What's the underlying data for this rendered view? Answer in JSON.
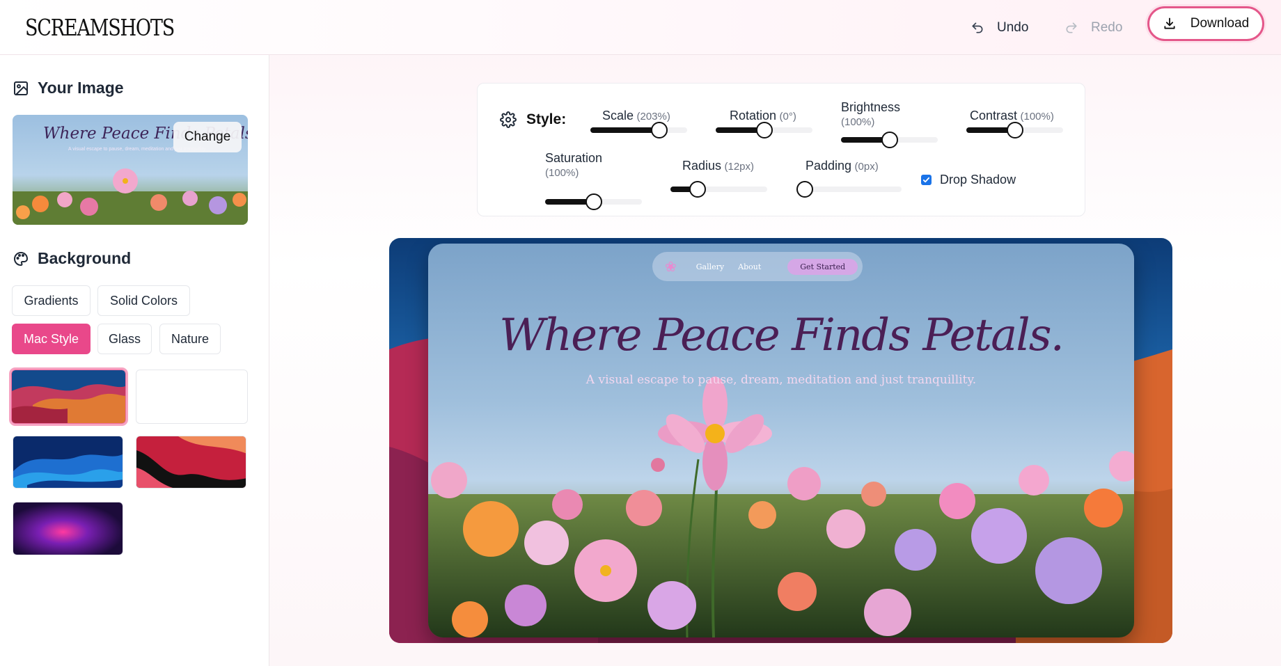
{
  "header": {
    "logo": "SCREAMSHOTS",
    "undo_label": "Undo",
    "redo_label": "Redo",
    "download_label": "Download",
    "undo_icon": "undo-icon",
    "redo_icon": "redo-icon",
    "download_icon": "download-icon"
  },
  "sidebar": {
    "image_section": {
      "title": "Your Image",
      "icon": "image-icon",
      "change_label": "Change"
    },
    "thumbnail": {
      "title": "Where Peace Finds Petals.",
      "subtitle": "A visual escape to pause, dream, meditation and just tranquillity."
    },
    "background_section": {
      "title": "Background",
      "icon": "palette-icon",
      "tabs": [
        "Gradients",
        "Solid Colors",
        "Mac Style",
        "Glass",
        "Nature"
      ],
      "active_tab": "Mac Style",
      "swatches": [
        "mac-sonoma-orange",
        "blank-white",
        "mac-blue-waves",
        "mac-red-black",
        "mac-purple-glow"
      ],
      "selected_swatch": "mac-sonoma-orange"
    }
  },
  "style": {
    "title": "Style:",
    "icon": "gear-icon",
    "controls": {
      "scale": {
        "label": "Scale",
        "unit": "(203%)",
        "level": 0.71
      },
      "rotation": {
        "label": "Rotation",
        "unit": "(0°)",
        "level": 0.5
      },
      "brightness": {
        "label": "Brightness",
        "unit": "(100%)",
        "level": 0.5
      },
      "contrast": {
        "label": "Contrast",
        "unit": "(100%)",
        "level": 0.5
      },
      "saturation": {
        "label": "Saturation",
        "unit": "(100%)",
        "level": 0.5
      },
      "radius": {
        "label": "Radius",
        "unit": "(12px)",
        "level": 0.28
      },
      "padding": {
        "label": "Padding",
        "unit": "(0px)",
        "level": 0.0
      }
    },
    "drop_shadow": {
      "label": "Drop Shadow",
      "checked": true
    }
  },
  "preview": {
    "nav": {
      "gallery": "Gallery",
      "about": "About",
      "cta": "Get Started",
      "logo_icon": "flower-icon"
    },
    "title": "Where Peace Finds Petals.",
    "subtitle": "A visual escape to pause, dream, meditation and just tranquillity."
  }
}
